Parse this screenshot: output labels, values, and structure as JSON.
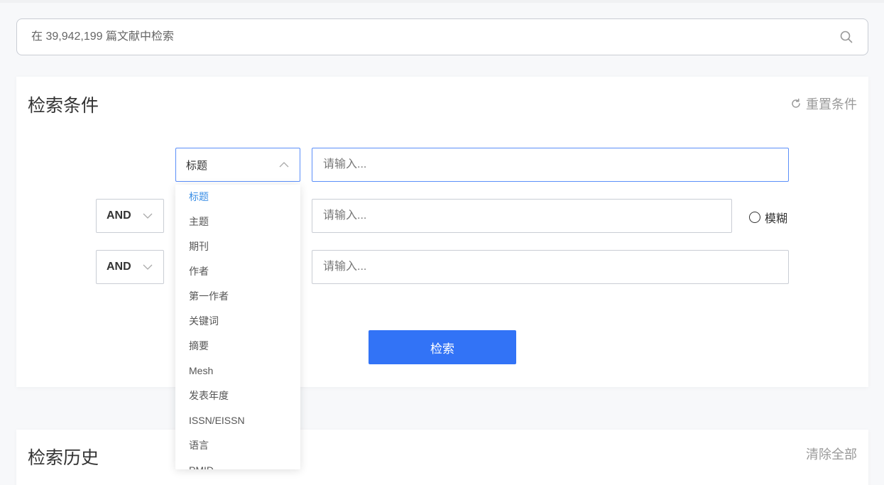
{
  "search": {
    "placeholder": "在 39,942,199 篇文献中检索"
  },
  "conditions": {
    "title": "检索条件",
    "reset_label": "重置条件",
    "rows": [
      {
        "field": "标题",
        "placeholder": "请输入..."
      },
      {
        "operator": "AND",
        "placeholder": "请输入...",
        "fuzzy_label": "模糊"
      },
      {
        "operator": "AND",
        "placeholder": "请输入..."
      }
    ],
    "submit_label": "检索"
  },
  "dropdown": {
    "selected": "标题",
    "options": [
      "标题",
      "主题",
      "期刊",
      "作者",
      "第一作者",
      "关键词",
      "摘要",
      "Mesh",
      "发表年度",
      "ISSN/EISSN",
      "语言",
      "PMID"
    ]
  },
  "history": {
    "title": "检索历史",
    "clear_label": "清除全部"
  },
  "colors": {
    "primary": "#3273f6",
    "selected_option": "#3a8ee6",
    "focus_border": "#5b8ff9"
  }
}
